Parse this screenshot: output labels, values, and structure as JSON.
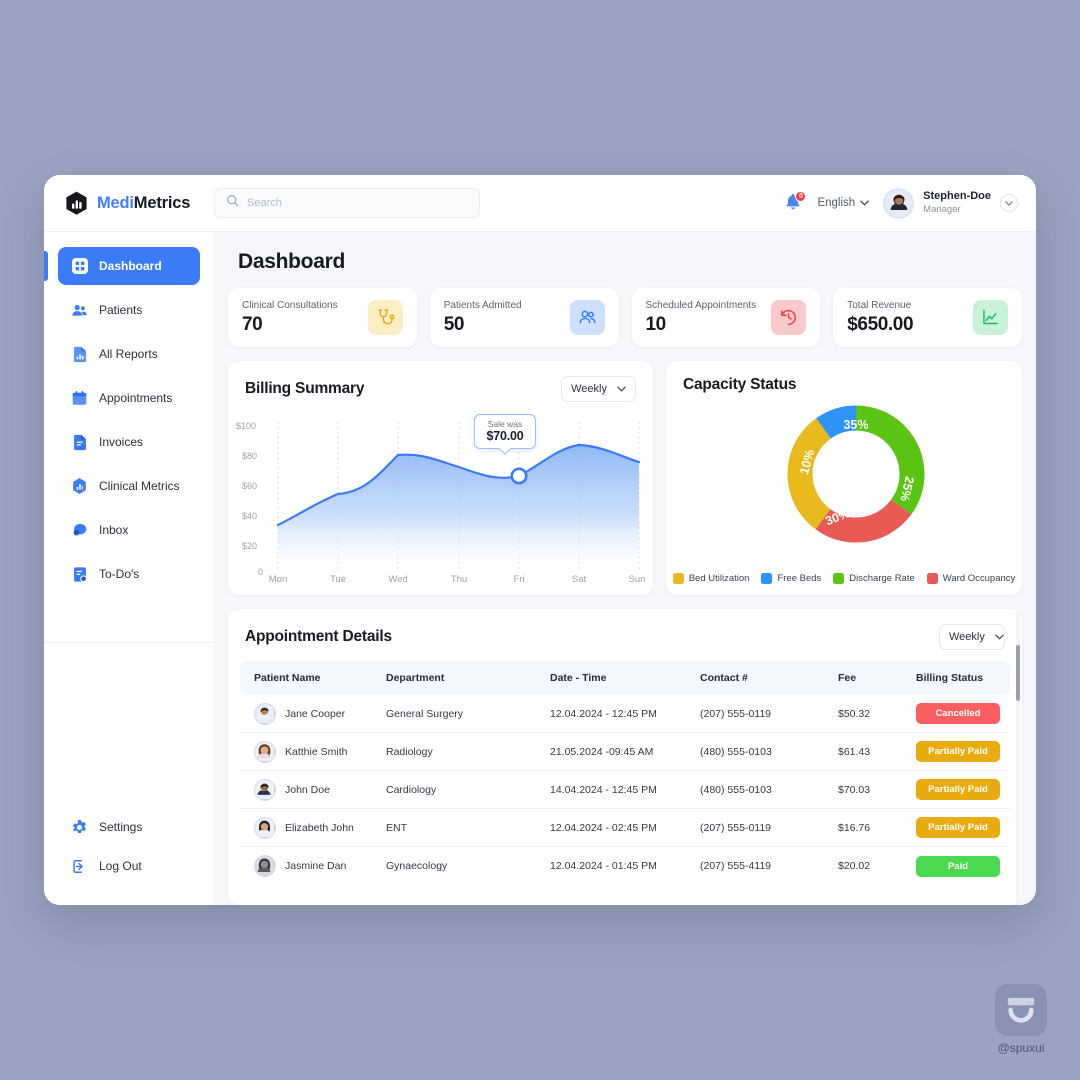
{
  "brand": {
    "part1": "Medi",
    "part2": "Metrics"
  },
  "topbar": {
    "search_placeholder": "Search",
    "notification_count": "0",
    "language": "English",
    "user_name": "Stephen-Doe",
    "user_role": "Manager"
  },
  "sidebar": {
    "items": [
      {
        "label": "Dashboard",
        "icon": "grid-icon",
        "active": true
      },
      {
        "label": "Patients",
        "icon": "users-icon",
        "active": false
      },
      {
        "label": "All Reports",
        "icon": "report-icon",
        "active": false
      },
      {
        "label": "Appointments",
        "icon": "calendar-icon",
        "active": false
      },
      {
        "label": "Invoices",
        "icon": "invoice-icon",
        "active": false
      },
      {
        "label": "Clinical Metrics",
        "icon": "metrics-icon",
        "active": false
      },
      {
        "label": "Inbox",
        "icon": "chat-icon",
        "active": false
      },
      {
        "label": "To-Do's",
        "icon": "todo-icon",
        "active": false
      }
    ],
    "bottom": [
      {
        "label": "Settings",
        "icon": "gear-icon"
      },
      {
        "label": "Log Out",
        "icon": "logout-icon"
      }
    ]
  },
  "page": {
    "title": "Dashboard"
  },
  "kpis": [
    {
      "label": "Clinical Consultations",
      "value": "70",
      "icon": "stethoscope-icon",
      "bg": "#fbeec2",
      "fg": "#e6a817"
    },
    {
      "label": "Patients Admitted",
      "value": "50",
      "icon": "people-icon",
      "bg": "#cfe0fd",
      "fg": "#2f7df4"
    },
    {
      "label": "Scheduled Appointments",
      "value": "10",
      "icon": "clock-history-icon",
      "bg": "#fbc9cb",
      "fg": "#ef3f45"
    },
    {
      "label": "Total Revenue",
      "value": "$650.00",
      "icon": "line-chart-icon",
      "bg": "#c9f3d8",
      "fg": "#1fbd62"
    }
  ],
  "billing": {
    "title": "Billing Summary",
    "range_label": "Weekly",
    "tooltip_label": "Sale was",
    "tooltip_value": "$70.00"
  },
  "capacity": {
    "title": "Capacity Status"
  },
  "appointments": {
    "title": "Appointment Details",
    "range_label": "Weekly",
    "columns": [
      "Patient Name",
      "Department",
      "Date - Time",
      "Contact #",
      "Fee",
      "Billing Status"
    ],
    "rows": [
      {
        "name": "Jane Cooper",
        "dept": "General Surgery",
        "date": "12.04.2024 - 12:45 PM",
        "contact": "(207) 555-0119",
        "fee": "$50.32",
        "status": "Cancelled",
        "status_color": "#fc5f5f"
      },
      {
        "name": "Katthie Smith",
        "dept": "Radiology",
        "date": "21.05.2024 -09:45 AM",
        "contact": "(480) 555-0103",
        "fee": "$61.43",
        "status": "Partially Paid",
        "status_color": "#e8ac10"
      },
      {
        "name": "John Doe",
        "dept": "Cardiology",
        "date": "14.04.2024 - 12:45 PM",
        "contact": "(480) 555-0103",
        "fee": "$70.03",
        "status": "Partially Paid",
        "status_color": "#e8ac10"
      },
      {
        "name": "Elizabeth John",
        "dept": "ENT",
        "date": "12.04.2024 - 02:45 PM",
        "contact": "(207) 555-0119",
        "fee": "$16.76",
        "status": "Partially Paid",
        "status_color": "#e8ac10"
      },
      {
        "name": "Jasmine Dan",
        "dept": "Gynaecology",
        "date": "12.04.2024 - 01:45 PM",
        "contact": "(207) 555-4119",
        "fee": "$20.02",
        "status": "Paid",
        "status_color": "#4bd martin"
      }
    ]
  },
  "watermark": {
    "handle": "@spuxui"
  },
  "colors": {
    "accent": "#3b7bf6",
    "canvas": "#9aa4c0",
    "surface": "#ffffff",
    "page_bg": "#f5f7fb"
  },
  "chart_data": [
    {
      "type": "area",
      "title": "Billing Summary",
      "xlabel": "",
      "ylabel": "",
      "categories": [
        "Mon",
        "Tue",
        "Wed",
        "Thu",
        "Fri",
        "Sat",
        "Sun"
      ],
      "values": [
        34,
        57,
        86,
        78,
        70,
        91,
        79
      ],
      "ytick_labels": [
        "0",
        "$20",
        "$40",
        "$60",
        "$80",
        "$100"
      ],
      "ylim": [
        0,
        110
      ],
      "grid": true,
      "legend": "none",
      "annotations": [
        {
          "x": "Fri",
          "y": 70,
          "label": "Sale was",
          "value": "$70.00"
        }
      ],
      "line_color": "#3b7bf6",
      "fill_top": "#9dc0f7",
      "fill_bottom": "#ffffff"
    },
    {
      "type": "pie",
      "title": "Capacity Status",
      "labels": [
        "Bed Utilization",
        "Free Beds",
        "Discharge Rate",
        "Ward Occupancy"
      ],
      "values": [
        30,
        10,
        35,
        25
      ],
      "value_labels": [
        "30%",
        "10%",
        "35%",
        "25%"
      ],
      "colors": [
        "#e8ba1e",
        "#2f93f7",
        "#5bc313",
        "#ea5a55"
      ],
      "legend": "bottom",
      "donut": true
    }
  ]
}
